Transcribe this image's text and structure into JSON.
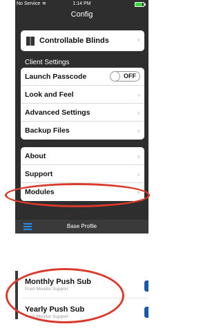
{
  "status_bar": {
    "carrier": "No Service",
    "time": "1:14 PM"
  },
  "nav": {
    "title": "Config"
  },
  "blinds_item": {
    "label": "Controllable Blinds"
  },
  "client_settings": {
    "header": "Client Settings",
    "launch_passcode": {
      "label": "Launch Passcode",
      "toggle_state": "OFF"
    },
    "items": [
      "Look and Feel",
      "Advanced Settings",
      "Backup Files"
    ]
  },
  "info_items": [
    "About",
    "Support",
    "Modules"
  ],
  "tab_bar": {
    "label": "Base Profile"
  },
  "subscriptions": [
    {
      "title": "Monthly Push Sub",
      "subtitle": "Push Monitor Support"
    },
    {
      "title": "Yearly Push Sub",
      "subtitle": "Push Monitor Support"
    }
  ],
  "colors": {
    "highlight": "#d93a2b",
    "background_dark": "#2e2e2e",
    "tab_icon": "#1e8fff"
  }
}
